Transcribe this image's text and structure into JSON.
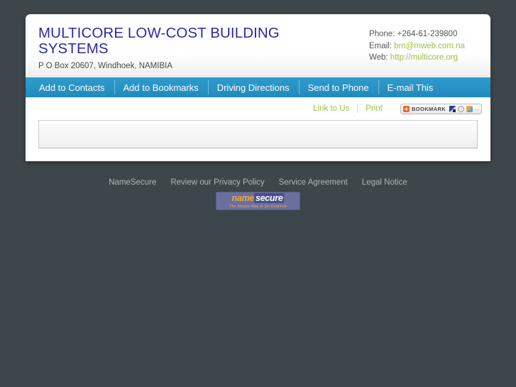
{
  "business": {
    "name": "MULTICORE LOW-COST BUILDING SYSTEMS",
    "address": "P O Box 20607, Windhoek, NAMIBIA",
    "title_color": "#2b2ba0"
  },
  "contact": {
    "phone_label": "Phone:",
    "phone_value": "+264-61-239800",
    "email_label": "Email:",
    "email_value": "brn@mweb.com.na",
    "web_label": "Web:",
    "web_value": "http://multicore.org",
    "link_color": "#9cc13f"
  },
  "nav": {
    "accent_color": "#2892c4",
    "items": [
      {
        "label": "Add to Contacts"
      },
      {
        "label": "Add to Bookmarks"
      },
      {
        "label": "Driving Directions"
      },
      {
        "label": "Send to Phone"
      },
      {
        "label": "E-mail This"
      }
    ]
  },
  "tools": {
    "link_to_us": "Link to Us",
    "print": "Print",
    "bookmark_widget": {
      "label": "BOOKMARK",
      "plus_icon": "plus-icon",
      "share_icons": [
        "windows-icon",
        "globe-icon",
        "colors-icon"
      ],
      "more": "..."
    }
  },
  "content": {
    "panel_text": ""
  },
  "footer": {
    "links": [
      {
        "label": "NameSecure"
      },
      {
        "label": "Review our Privacy Policy"
      },
      {
        "label": "Service Agreement"
      },
      {
        "label": "Legal Notice"
      }
    ],
    "logo": {
      "name_part": "name",
      "secure_part": "secure",
      "tagline": "The Simple Way to Do Domains"
    }
  }
}
